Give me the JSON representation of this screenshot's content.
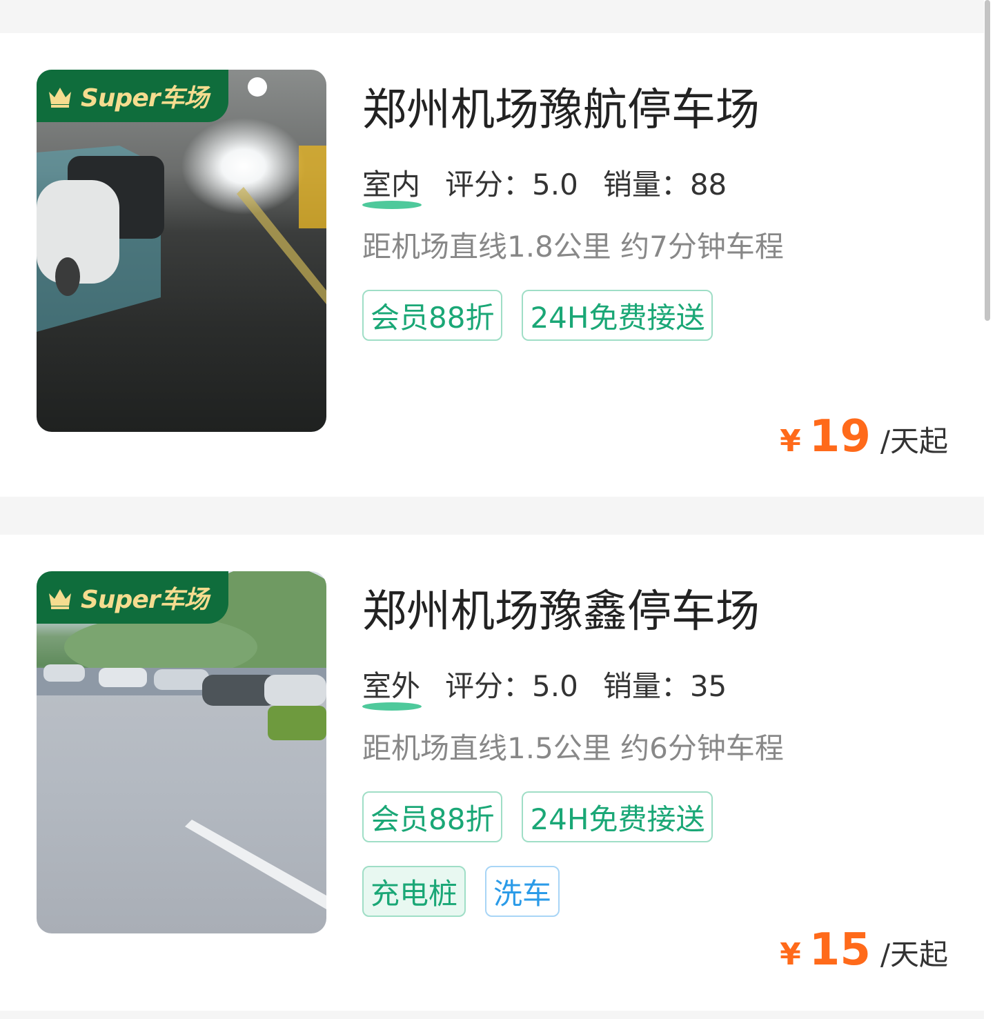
{
  "badge_label": "Super车场",
  "listings": [
    {
      "name": "郑州机场豫航停车场",
      "type": "室内",
      "rating": "评分：5.0",
      "sales": "销量：88",
      "distance": "距机场直线1.8公里 约7分钟车程",
      "tags": [
        "会员88折",
        "24H免费接送"
      ],
      "extra_tags": [],
      "currency": "¥",
      "price": "19",
      "unit": "/天起"
    },
    {
      "name": "郑州机场豫鑫停车场",
      "type": "室外",
      "rating": "评分：5.0",
      "sales": "销量：35",
      "distance": "距机场直线1.5公里 约6分钟车程",
      "tags": [
        "会员88折",
        "24H免费接送"
      ],
      "extra_tags": [
        "充电桩",
        "洗车"
      ],
      "currency": "¥",
      "price": "15",
      "unit": "/天起"
    }
  ]
}
